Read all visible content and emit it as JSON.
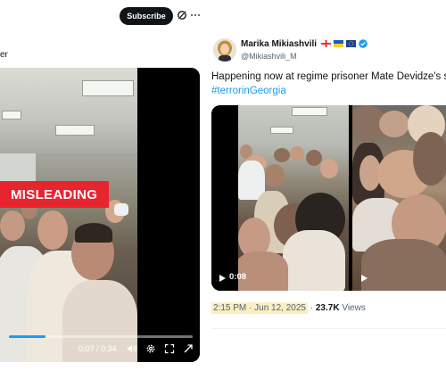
{
  "left_post": {
    "subscribe_label": "Subscribe",
    "text_fragment": "er",
    "badge_label": "MISLEADING",
    "video": {
      "time": "0:07 / 0:34",
      "progress": 0.2
    }
  },
  "right_post": {
    "author": {
      "name": "Marika Mikiashvili",
      "handle": "@Mikiashvili_M"
    },
    "text": "Happening now at regime prisoner Mate Devidze's s",
    "hashtag": "#terrorinGeorgia",
    "video": {
      "time": "0:08"
    },
    "timestamp": "2:15 PM · Jun 12, 2025",
    "dot": "·",
    "views_count": "23.7K",
    "views_label": "Views"
  },
  "colors": {
    "accent": "#1d9bf0",
    "badge": "#e8242f",
    "highlight": "#fbeec3",
    "text_primary": "#0f1419",
    "text_secondary": "#536471"
  },
  "icons": [
    "grok-icon",
    "more-icon",
    "volume-icon",
    "settings-icon",
    "fullscreen-icon",
    "play-icon",
    "verified-icon",
    "flag-georgia-icon",
    "flag-ukraine-icon",
    "flag-eu-icon"
  ]
}
